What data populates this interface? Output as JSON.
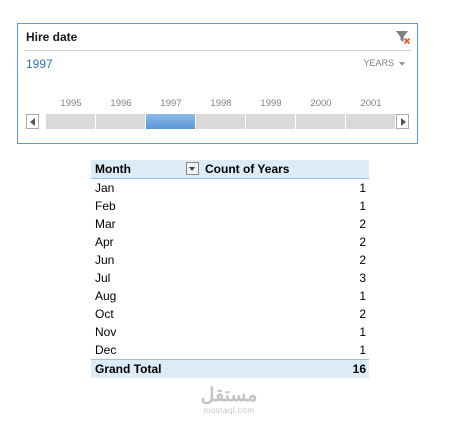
{
  "timeline": {
    "title": "Hire date",
    "selected_label": "1997",
    "level_label": "YEARS",
    "years": [
      {
        "label": "1995",
        "selected": false
      },
      {
        "label": "1996",
        "selected": false
      },
      {
        "label": "1997",
        "selected": true
      },
      {
        "label": "1998",
        "selected": false
      },
      {
        "label": "1999",
        "selected": false
      },
      {
        "label": "2000",
        "selected": false
      },
      {
        "label": "2001",
        "selected": false
      }
    ]
  },
  "pivot": {
    "header_row": "Month",
    "header_value": "Count of Years",
    "rows": [
      {
        "month": "Jan",
        "count": "1"
      },
      {
        "month": "Feb",
        "count": "1"
      },
      {
        "month": "Mar",
        "count": "2"
      },
      {
        "month": "Apr",
        "count": "2"
      },
      {
        "month": "Jun",
        "count": "2"
      },
      {
        "month": "Jul",
        "count": "3"
      },
      {
        "month": "Aug",
        "count": "1"
      },
      {
        "month": "Oct",
        "count": "2"
      },
      {
        "month": "Nov",
        "count": "1"
      },
      {
        "month": "Dec",
        "count": "1"
      }
    ],
    "total_label": "Grand Total",
    "total_value": "16"
  },
  "watermark": {
    "logo": "مستقل",
    "sub": "mostaql.com"
  },
  "colors": {
    "accent": "#5b9bd5",
    "selected_text": "#2e75b6",
    "header_fill": "#ddebf7",
    "clear_filter_x": "#e8502a"
  },
  "icons": {
    "clear_filter": "filter-clear-icon",
    "level_dropdown": "chevron-down-icon",
    "scroll_left": "scroll-left-arrow-icon",
    "scroll_right": "scroll-right-arrow-icon",
    "column_filter": "filter-dropdown-icon"
  }
}
